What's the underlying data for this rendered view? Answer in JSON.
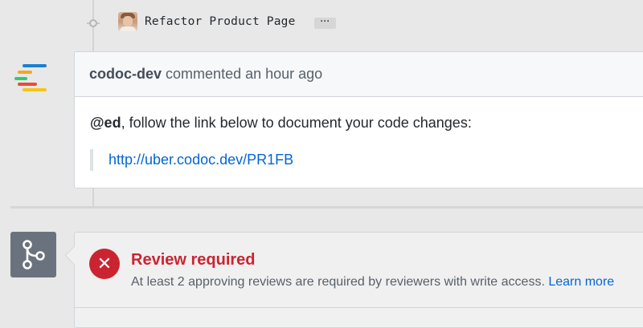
{
  "commit": {
    "message": "Refactor Product Page",
    "more_label": "···",
    "avatar_icon": "user-avatar"
  },
  "comment": {
    "author": "codoc-dev",
    "action": "commented",
    "time": "an hour ago",
    "mention": "@ed",
    "body_text": ", follow the link below to document your code changes:",
    "link": "http://uber.codoc.dev/PR1FB",
    "bot_logo_colors": [
      "#1a7fd4",
      "#f5a623",
      "#2ecc71",
      "#e74c3c",
      "#f5c518"
    ]
  },
  "merge_status": {
    "icon": "git-pull-request-icon",
    "status_icon": "x-icon",
    "title": "Review required",
    "description": "At least 2 approving reviews are required by reviewers with write access.",
    "learn_more": "Learn more",
    "colors": {
      "error": "#cb2431",
      "link": "#0366d6"
    }
  }
}
